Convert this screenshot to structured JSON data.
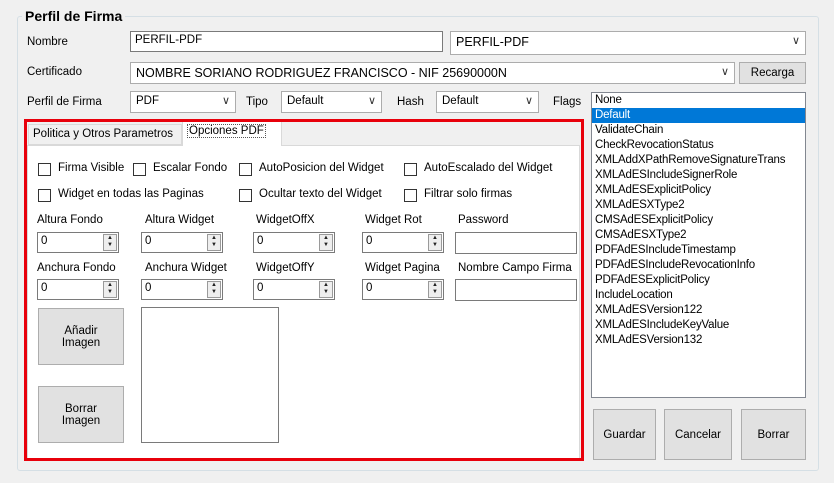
{
  "group_title": "Perfil de Firma",
  "nombre": {
    "label": "Nombre",
    "value": "PERFIL-PDF",
    "combo_value": "PERFIL-PDF"
  },
  "certificado": {
    "label": "Certificado",
    "value": "NOMBRE SORIANO RODRIGUEZ FRANCISCO - NIF 25690000N",
    "recarga_label": "Recarga"
  },
  "perfil_row": {
    "perfil_label": "Perfil de Firma",
    "perfil_value": "PDF",
    "tipo_label": "Tipo",
    "tipo_value": "Default",
    "hash_label": "Hash",
    "hash_value": "Default",
    "flags_label": "Flags"
  },
  "flags": [
    "None",
    "Default",
    "ValidateChain",
    "CheckRevocationStatus",
    "XMLAddXPathRemoveSignatureTrans",
    "XMLAdESIncludeSignerRole",
    "XMLAdESExplicitPolicy",
    "XMLAdESXType2",
    "CMSAdESExplicitPolicy",
    "CMSAdESXType2",
    "PDFAdESIncludeTimestamp",
    "PDFAdESIncludeRevocationInfo",
    "PDFAdESExplicitPolicy",
    "IncludeLocation",
    "XMLAdESVersion122",
    "XMLAdESIncludeKeyValue",
    "XMLAdESVersion132"
  ],
  "flags_selected": "Default",
  "tabs": {
    "tab1": "Politica y Otros Parametros",
    "tab2": "Opciones PDF"
  },
  "checkboxes": {
    "firma_visible": "Firma Visible",
    "escalar_fondo": "Escalar Fondo",
    "auto_posicion": "AutoPosicion del Widget",
    "auto_escalado": "AutoEscalado del Widget",
    "widget_todas": "Widget en todas las Paginas",
    "ocultar_texto": "Ocultar texto del Widget",
    "filtrar_firmas": "Filtrar solo firmas"
  },
  "fields": {
    "altura_fondo": {
      "label": "Altura Fondo",
      "value": "0"
    },
    "altura_widget": {
      "label": "Altura Widget",
      "value": "0"
    },
    "widget_offx": {
      "label": "WidgetOffX",
      "value": "0"
    },
    "widget_rot": {
      "label": "Widget Rot",
      "value": "0"
    },
    "password": {
      "label": "Password",
      "value": ""
    },
    "anchura_fondo": {
      "label": "Anchura Fondo",
      "value": "0"
    },
    "anchura_widget": {
      "label": "Anchura Widget",
      "value": "0"
    },
    "widget_offy": {
      "label": "WidgetOffY",
      "value": "0"
    },
    "widget_pagina": {
      "label": "Widget Pagina",
      "value": "0"
    },
    "nombre_campo": {
      "label": "Nombre Campo Firma",
      "value": ""
    }
  },
  "buttons": {
    "anadir_1": "Añadir",
    "anadir_2": "Imagen",
    "borrar_img_1": "Borrar",
    "borrar_img_2": "Imagen",
    "guardar": "Guardar",
    "cancelar": "Cancelar",
    "borrar": "Borrar"
  }
}
